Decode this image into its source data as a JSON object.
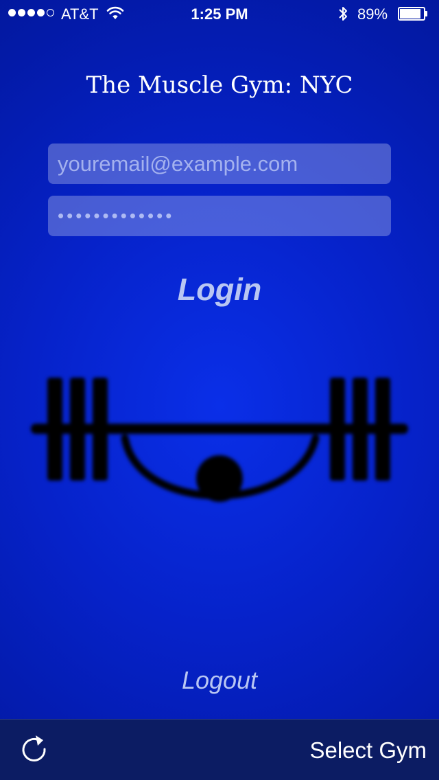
{
  "status_bar": {
    "signal_filled": 4,
    "signal_total": 5,
    "carrier": "AT&T",
    "time": "1:25 PM",
    "battery_percent": "89%",
    "battery_level": 0.89,
    "icons": [
      "signal-dots",
      "wifi-icon",
      "bluetooth-icon",
      "battery-icon"
    ]
  },
  "title": "The Muscle Gym: NYC",
  "login_form": {
    "email_placeholder": "youremail@example.com",
    "email_value": "",
    "password_value": "•••••••••••••"
  },
  "login_label": "Login",
  "logo_icon": "barbell-lifter-logo",
  "logout_label": "Logout",
  "toolbar": {
    "refresh_icon": "refresh-icon",
    "select_gym_label": "Select Gym"
  },
  "colors": {
    "background": "#0622c9",
    "link_text": "#b9c6f3",
    "toolbar": "#0c1c63",
    "field_bg": "rgba(190,200,240,0.36)"
  }
}
